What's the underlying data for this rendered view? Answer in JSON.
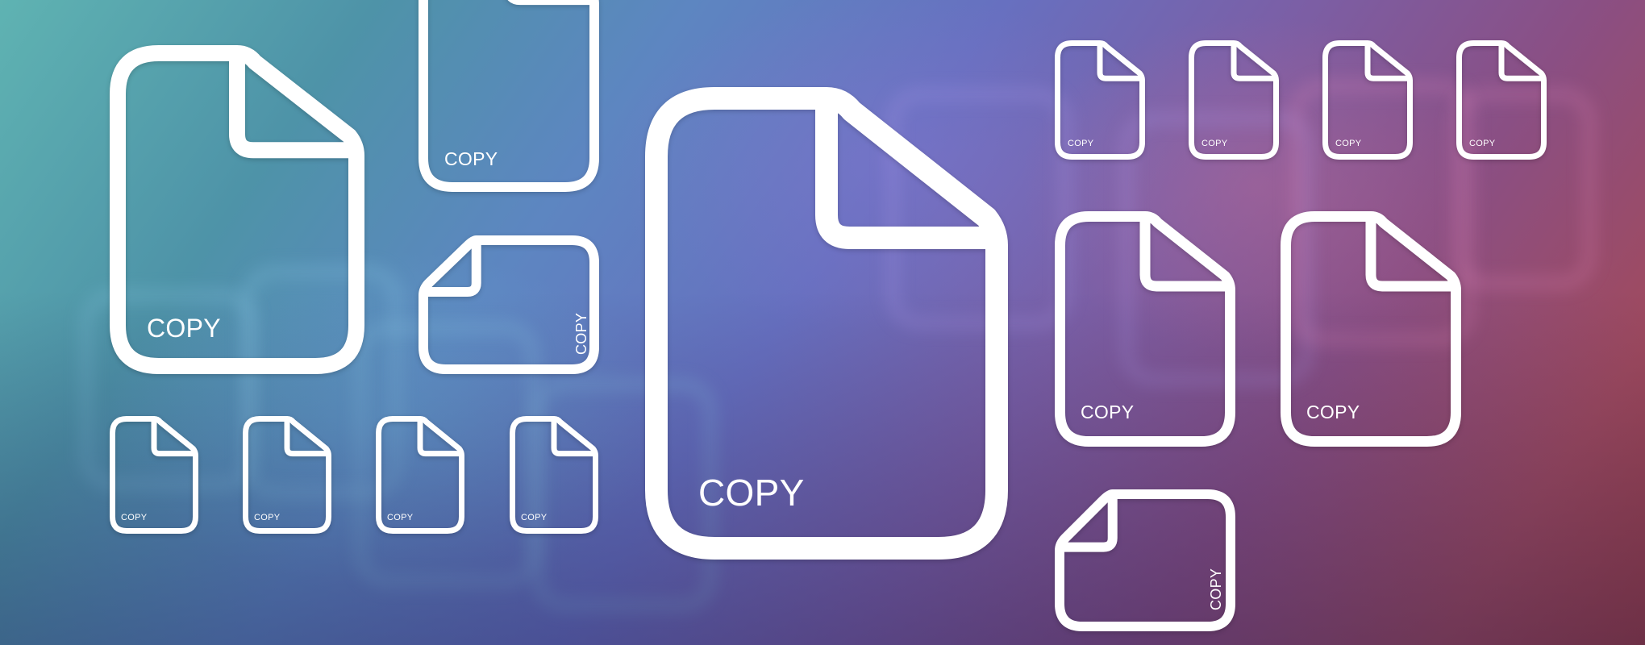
{
  "scene": {
    "description": "Collection of outlined document (file) icons labeled COPY on a teal-to-purple-to-red gradient",
    "colors": {
      "icon_stroke": "#ffffff",
      "label_text": "#ffffff",
      "gradient_start": "#5fb3b2",
      "gradient_mid": "#6770c0",
      "gradient_end": "#9d3f46"
    }
  },
  "icons": [
    {
      "id": "large-left",
      "icon": "document-icon",
      "orientation": "portrait",
      "label": "COPY"
    },
    {
      "id": "top-middle-cropped",
      "icon": "document-icon",
      "orientation": "portrait",
      "label": "COPY"
    },
    {
      "id": "landscape-left",
      "icon": "document-icon",
      "orientation": "landscape",
      "label": "COPY"
    },
    {
      "id": "small-left-1",
      "icon": "document-icon",
      "orientation": "portrait",
      "label": "COPY"
    },
    {
      "id": "small-left-2",
      "icon": "document-icon",
      "orientation": "portrait",
      "label": "COPY"
    },
    {
      "id": "small-left-3",
      "icon": "document-icon",
      "orientation": "portrait",
      "label": "COPY"
    },
    {
      "id": "small-left-4",
      "icon": "document-icon",
      "orientation": "portrait",
      "label": "COPY"
    },
    {
      "id": "hero-center",
      "icon": "document-icon",
      "orientation": "portrait",
      "label": "COPY"
    },
    {
      "id": "small-right-1",
      "icon": "document-icon",
      "orientation": "portrait",
      "label": "COPY"
    },
    {
      "id": "small-right-2",
      "icon": "document-icon",
      "orientation": "portrait",
      "label": "COPY"
    },
    {
      "id": "small-right-3",
      "icon": "document-icon",
      "orientation": "portrait",
      "label": "COPY"
    },
    {
      "id": "small-right-4",
      "icon": "document-icon",
      "orientation": "portrait",
      "label": "COPY"
    },
    {
      "id": "medium-right-1",
      "icon": "document-icon",
      "orientation": "portrait",
      "label": "COPY"
    },
    {
      "id": "medium-right-2",
      "icon": "document-icon",
      "orientation": "portrait",
      "label": "COPY"
    },
    {
      "id": "landscape-right",
      "icon": "document-icon",
      "orientation": "landscape",
      "label": "COPY"
    }
  ]
}
